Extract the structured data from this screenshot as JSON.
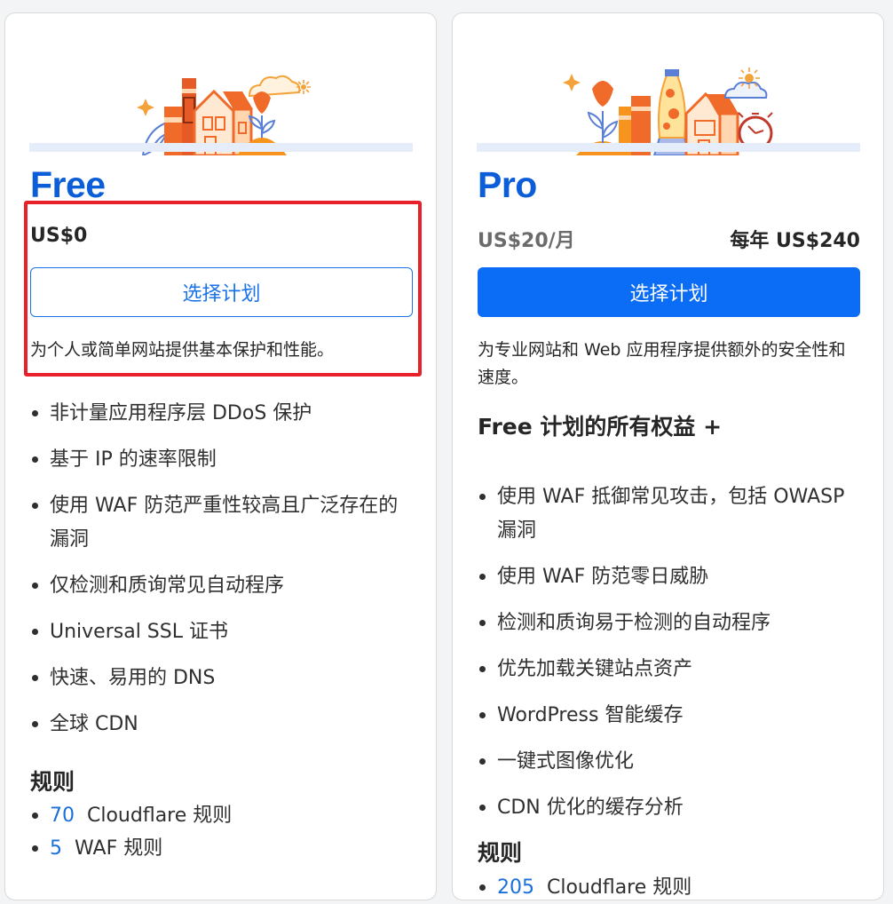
{
  "free": {
    "name": "Free",
    "price": "US$0",
    "button": "选择计划",
    "description": "为个人或简单网站提供基本保护和性能。",
    "features": [
      "非计量应用程序层 DDoS 保护",
      "基于 IP 的速率限制",
      "使用 WAF 防范严重性较高且广泛存在的漏洞",
      "仅检测和质询常见自动程序",
      "Universal SSL 证书",
      "快速、易用的 DNS",
      "全球 CDN"
    ],
    "rules_title": "规则",
    "rules": [
      {
        "num": "70",
        "label": "Cloudflare 规则"
      },
      {
        "num": "5",
        "label": "WAF 规则"
      }
    ]
  },
  "pro": {
    "name": "Pro",
    "price": "US$20/月",
    "annual": "每年 US$240",
    "button": "选择计划",
    "description": "为专业网站和 Web 应用程序提供额外的安全性和速度。",
    "inherit_title": "Free 计划的所有权益 +",
    "features": [
      "使用 WAF 抵御常见攻击，包括 OWASP 漏洞",
      "使用 WAF 防范零日威胁",
      "检测和质询易于检测的自动程序",
      "优先加载关键站点资产",
      "WordPress 智能缓存",
      "一键式图像优化",
      "CDN 优化的缓存分析"
    ],
    "rules_title": "规则",
    "rules": [
      {
        "num": "205",
        "label": "Cloudflare 规则"
      }
    ]
  },
  "colors": {
    "accent": "#0b6cf5",
    "plan_name": "#0b5ed7",
    "highlight": "#e8202a"
  },
  "icons": {
    "free_illustration": "books-house-flower-illustration",
    "pro_illustration": "flower-books-lavalamp-house-clock-illustration"
  }
}
